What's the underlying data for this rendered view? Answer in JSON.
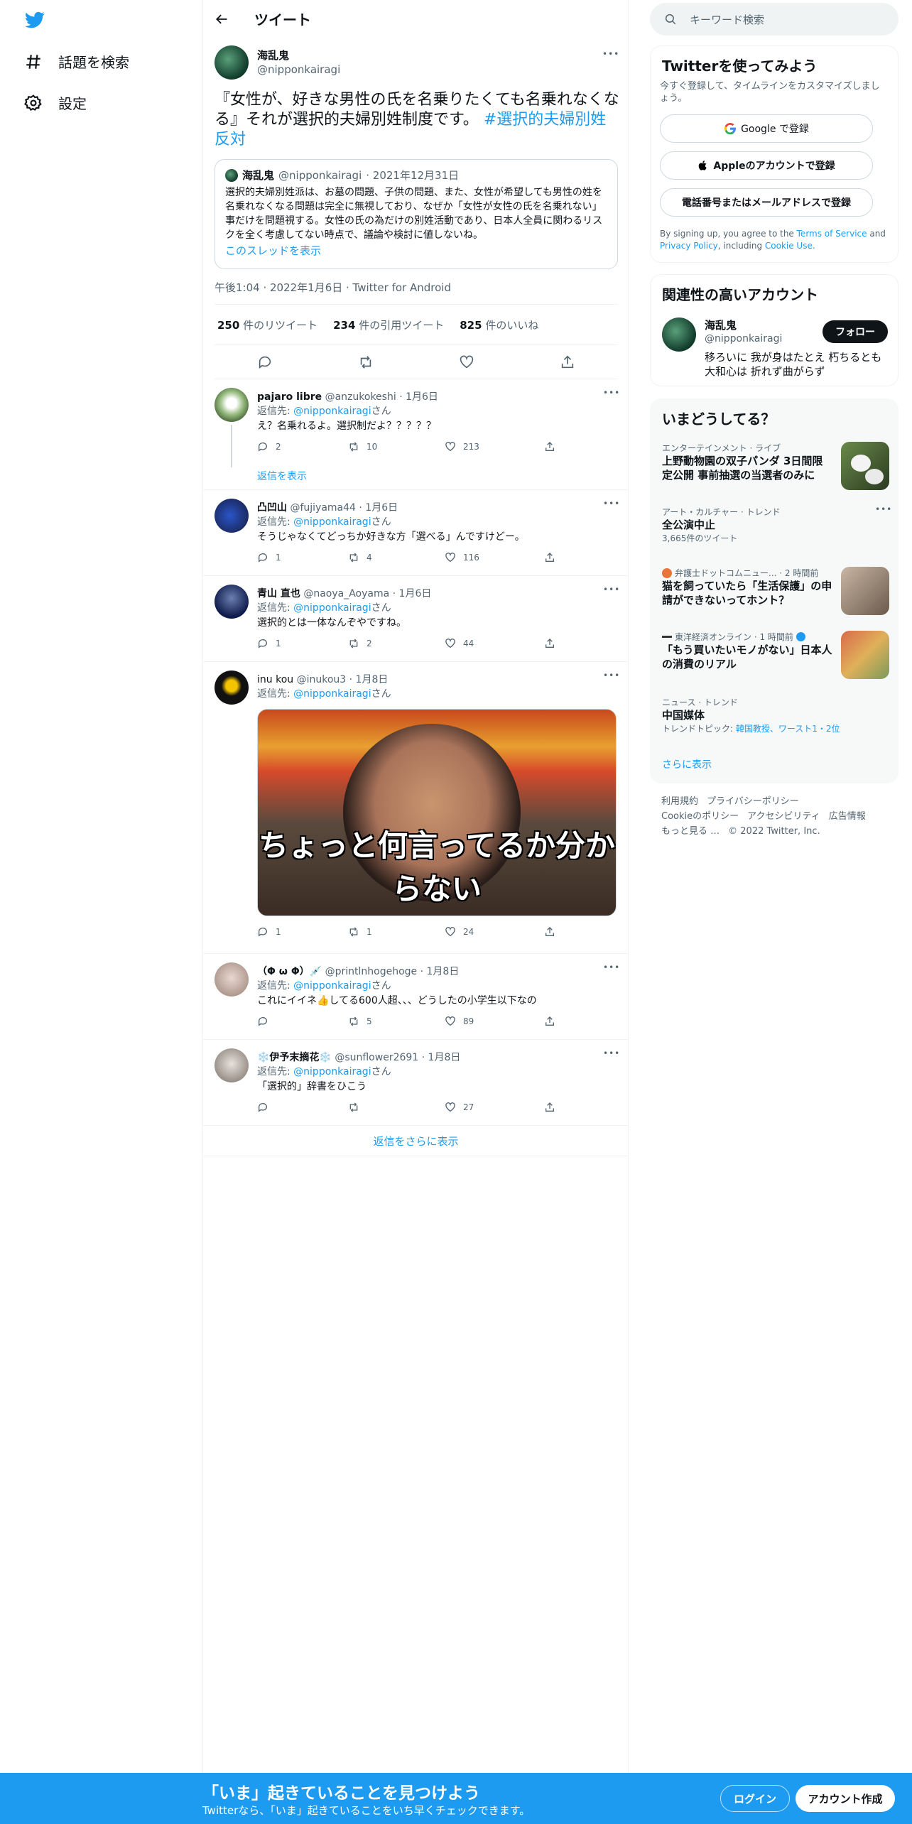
{
  "nav": {
    "explore": "話題を検索",
    "settings": "設定"
  },
  "header": {
    "title": "ツイート"
  },
  "tweet": {
    "name": "海乱鬼",
    "handle": "@nipponkairagi",
    "text": "『女性が、好きな男性の氏を名乗りたくても名乗れなくなる』それが選択的夫婦別姓制度です。",
    "hashtag": "#選択的夫婦別姓反対",
    "quote": {
      "name": "海乱鬼",
      "handle": "@nipponkairagi",
      "date": "· 2021年12月31日",
      "text": "選択的夫婦別姓派は、お墓の問題、子供の問題、また、女性が希望しても男性の姓を名乗れなくなる問題は完全に無視しており、なぜか「女性が女性の氏を名乗れない」事だけを問題視する。女性の氏の為だけの別姓活動であり、日本人全員に関わるリスクを全く考慮してない時点で、議論や検討に値しないね。",
      "thread_link": "このスレッドを表示"
    },
    "timestamp": "午後1:04 · 2022年1月6日 · Twitter for Android",
    "stats": {
      "retweets_count": "250",
      "retweets_label": "件のリツイート",
      "quotes_count": "234",
      "quotes_label": "件の引用ツイート",
      "likes_count": "825",
      "likes_label": "件のいいね"
    }
  },
  "replies": [
    {
      "name": "pajaro libre",
      "handle": "@anzukokeshi",
      "date": "· 1月6日",
      "reply_prefix": "返信先: ",
      "reply_to": "@nipponkairagi",
      "reply_suffix": "さん",
      "text": "え？名乗れるよ。選択制だよ？？？？？",
      "replies": "2",
      "retweets": "10",
      "likes": "213",
      "show_replies": "返信を表示"
    },
    {
      "name": "凸凹山",
      "handle": "@fujiyama44",
      "date": "· 1月6日",
      "reply_prefix": "返信先: ",
      "reply_to": "@nipponkairagi",
      "reply_suffix": "さん",
      "text": "そうじゃなくてどっちか好きな方「選べる」んですけどー。",
      "replies": "1",
      "retweets": "4",
      "likes": "116"
    },
    {
      "name": "青山 直也",
      "handle": "@naoya_Aoyama",
      "date": "· 1月6日",
      "reply_prefix": "返信先: ",
      "reply_to": "@nipponkairagi",
      "reply_suffix": "さん",
      "text": "選択的とは一体なんぞやですね。",
      "replies": "1",
      "retweets": "2",
      "likes": "44"
    },
    {
      "name": "inu kou",
      "handle": "@inukou3",
      "date": "· 1月8日",
      "reply_prefix": "返信先: ",
      "reply_to": "@nipponkairagi",
      "reply_suffix": "さん",
      "text": "",
      "image_caption": "ちょっと何言ってるか分からない",
      "replies": "1",
      "retweets": "1",
      "likes": "24"
    },
    {
      "name": "（Φ ω Φ）💉",
      "handle": "@printlnhogehoge",
      "date": "· 1月8日",
      "reply_prefix": "返信先: ",
      "reply_to": "@nipponkairagi",
      "reply_suffix": "さん",
      "text": "これにイイネ👍してる600人超、、、どうしたの小学生以下なの",
      "replies": "",
      "retweets": "5",
      "likes": "89"
    },
    {
      "name": "❄️伊予末摘花❄️",
      "handle": "@sunflower2691",
      "date": "· 1月8日",
      "reply_prefix": "返信先: ",
      "reply_to": "@nipponkairagi",
      "reply_suffix": "さん",
      "text": "「選択的」辞書をひこう",
      "replies": "",
      "retweets": "",
      "likes": "27"
    }
  ],
  "more_replies": "返信をさらに表示",
  "search": {
    "placeholder": "キーワード検索"
  },
  "signup": {
    "title": "Twitterを使ってみよう",
    "subtitle": "今すぐ登録して、タイムラインをカスタマイズしましょう。",
    "google": "Google で登録",
    "apple": "Appleのアカウントで登録",
    "phone": "電話番号またはメールアドレスで登録",
    "terms_prefix": "By signing up, you agree to the ",
    "terms_link": "Terms of Service",
    "terms_and": " and ",
    "privacy_link": "Privacy Policy",
    "including": ", including ",
    "cookie_link": "Cookie Use."
  },
  "related": {
    "title": "関連性の高いアカウント",
    "name": "海乱鬼",
    "handle": "@nipponkairagi",
    "follow": "フォロー",
    "bio": "移ろいに 我が身はたとえ 朽ちるとも 大和心は 折れず曲がらず"
  },
  "trends": {
    "title": "いまどうしてる？",
    "items": [
      {
        "meta": "エンターテインメント · ライブ",
        "title": "上野動物園の双子パンダ 3日間限定公開 事前抽選の当選者のみに",
        "count": ""
      },
      {
        "meta": "アート・カルチャー · トレンド",
        "title": "全公演中止",
        "count": "3,665件のツイート"
      },
      {
        "meta": "弁護士ドットコムニュー... · 2 時間前",
        "title": "猫を飼っていたら「生活保護」の申請ができないってホント？",
        "count": ""
      },
      {
        "meta": "東洋経済オンライン · 1 時間前",
        "title": "「もう買いたいモノがない」日本人の消費のリアル",
        "count": ""
      },
      {
        "meta": "ニュース · トレンド",
        "title": "中国媒体",
        "count_prefix": "トレンドトピック: ",
        "count_link": "韓国教授、ワースト1・2位"
      }
    ],
    "more": "さらに表示"
  },
  "footer": {
    "links": [
      "利用規約",
      "プライバシーポリシー",
      "Cookieのポリシー",
      "アクセシビリティ",
      "広告情報",
      "もっと見る …"
    ],
    "copyright": "© 2022 Twitter, Inc."
  },
  "bottombar": {
    "title": "「いま」起きていることを見つけよう",
    "subtitle": "Twitterなら、「いま」起きていることをいち早くチェックできます。",
    "login": "ログイン",
    "signup": "アカウント作成"
  },
  "colors": {
    "accent": "#1d9bf0",
    "text": "#0f1419",
    "muted": "#536471"
  }
}
